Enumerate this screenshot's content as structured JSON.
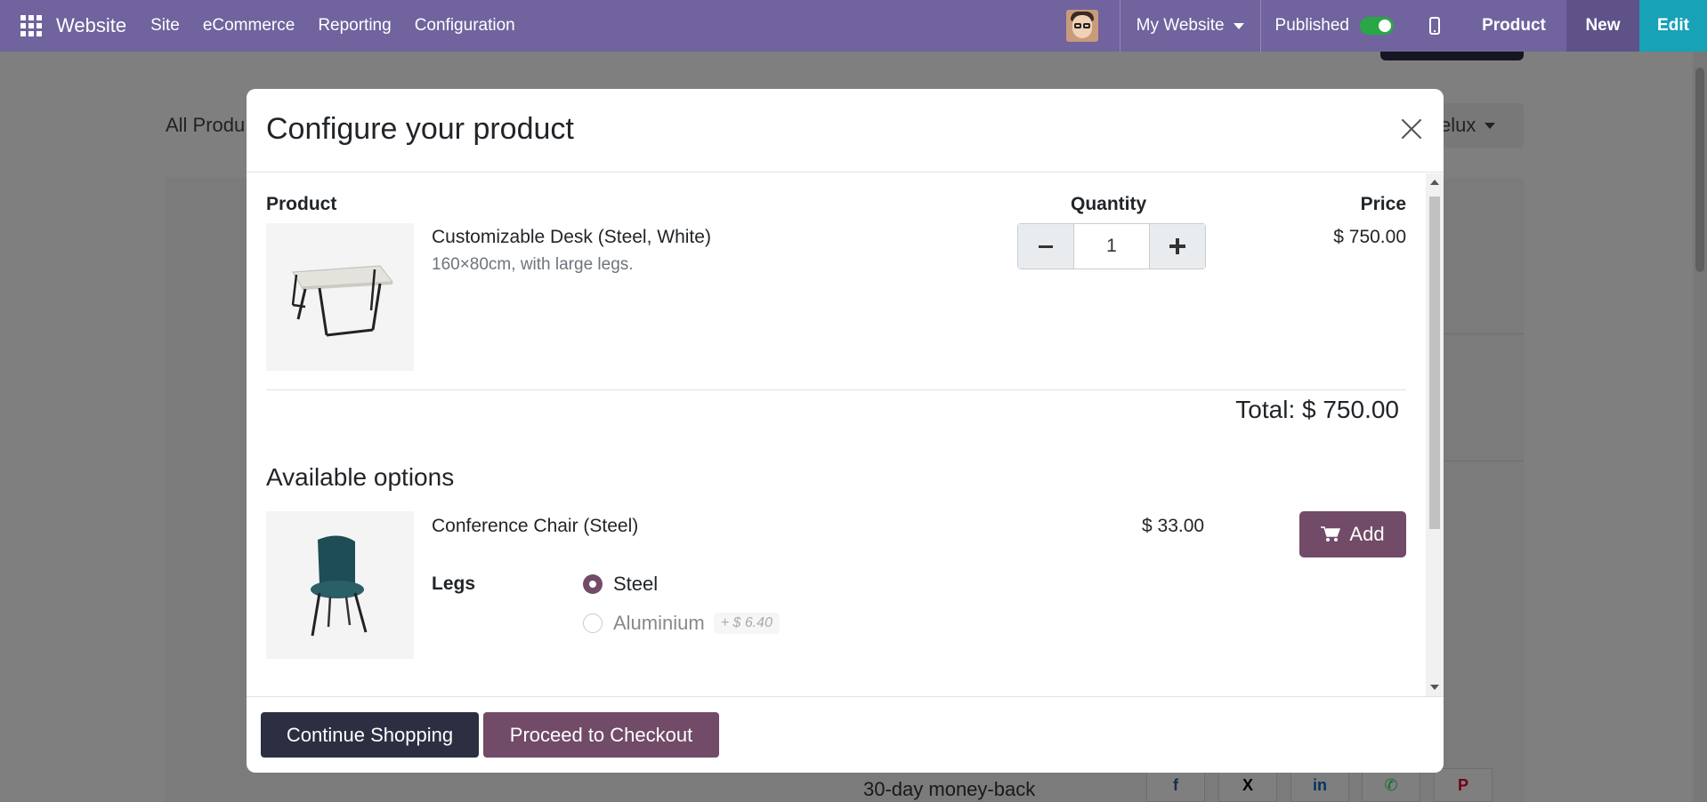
{
  "navbar": {
    "brand": "Website",
    "menu": [
      "Site",
      "eCommerce",
      "Reporting",
      "Configuration"
    ],
    "website_selector": "My Website",
    "published_label": "Published",
    "published": true,
    "product_label": "Product",
    "new_label": "New",
    "edit_label": "Edit",
    "colors": {
      "navbar": "#71639e",
      "new": "#5f5289",
      "edit": "#17a2b8"
    }
  },
  "background": {
    "all_products_label": "All Produ",
    "pricelist_label": "elux",
    "moneyback_text": "30-day money-back",
    "social_icons": [
      "facebook-icon",
      "x-icon",
      "linkedin-icon",
      "whatsapp-icon",
      "pinterest-icon"
    ]
  },
  "modal": {
    "title": "Configure your product",
    "columns": {
      "product": "Product",
      "quantity": "Quantity",
      "price": "Price"
    },
    "product": {
      "name": "Customizable Desk (Steel, White)",
      "description": "160×80cm, with large legs.",
      "quantity": "1",
      "price": "$ 750.00"
    },
    "total": "Total: $ 750.00",
    "available_options_title": "Available options",
    "option": {
      "name": "Conference Chair (Steel)",
      "price": "$ 33.00",
      "add_label": "Add",
      "attribute_label": "Legs",
      "values": [
        {
          "label": "Steel",
          "selected": true,
          "extra": ""
        },
        {
          "label": "Aluminium",
          "selected": false,
          "extra": "+ $ 6.40"
        }
      ]
    },
    "footer": {
      "continue_label": "Continue Shopping",
      "checkout_label": "Proceed to Checkout"
    },
    "colors": {
      "primary": "#714b67",
      "secondary": "#2c2f41"
    }
  }
}
